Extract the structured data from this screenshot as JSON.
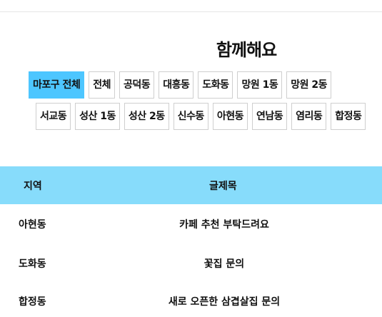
{
  "page": {
    "title": "함께해요"
  },
  "filters": {
    "row1": [
      "마포구 전체",
      "전체",
      "공덕동",
      "대흥동",
      "도화동",
      "망원 1동",
      "망원 2동"
    ],
    "row2": [
      "서교동",
      "성산 1동",
      "성산 2동",
      "신수동",
      "아현동",
      "연남동",
      "염리동",
      "합정동"
    ],
    "active": "마포구 전체"
  },
  "table": {
    "headers": {
      "region": "지역",
      "title": "글제목"
    },
    "rows": [
      {
        "region": "아현동",
        "title": "카페 추천 부탁드려요"
      },
      {
        "region": "도화동",
        "title": "꽃집 문의"
      },
      {
        "region": "합정동",
        "title": "새로 오픈한 삼겹살집 문의"
      }
    ]
  },
  "colors": {
    "active_chip": "#4dc6ff",
    "header_bg": "#87dcfb"
  }
}
